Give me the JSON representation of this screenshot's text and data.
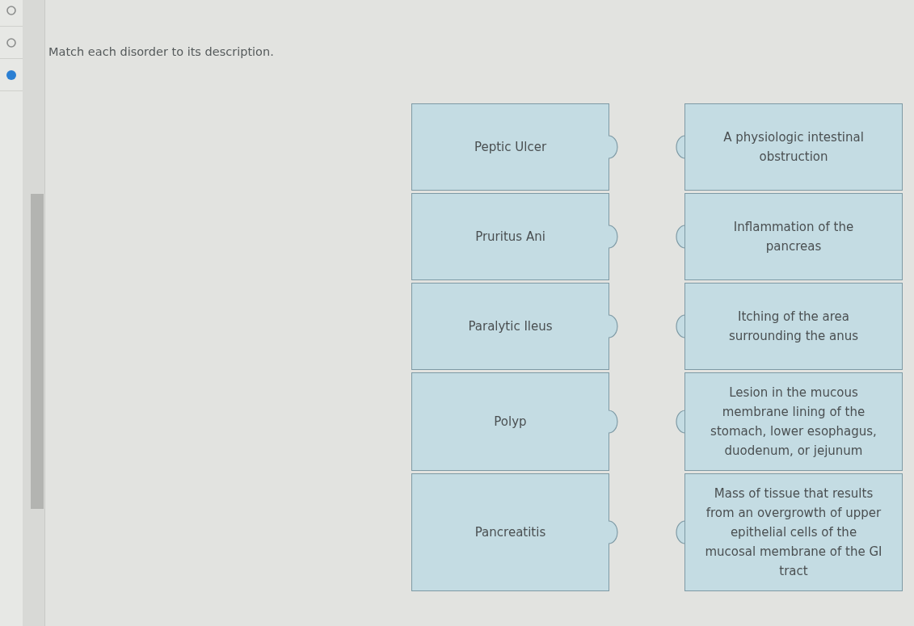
{
  "question_nav": [
    {
      "selected": false
    },
    {
      "selected": false
    },
    {
      "selected": true
    }
  ],
  "prompt": "Match each disorder to its description.",
  "terms": [
    "Peptic Ulcer",
    "Pruritus Ani",
    "Paralytic Ileus",
    "Polyp",
    "Pancreatitis"
  ],
  "descriptions": [
    "A physiologic intestinal\nobstruction",
    "Inflammation of the\npancreas",
    "Itching of the area\nsurrounding the anus",
    "Lesion in the mucous\nmembrane lining of the\nstomach, lower esophagus,\nduodenum, or jejunum",
    "Mass of tissue that results\nfrom an overgrowth of upper\nepithelial cells of the\nmucosal membrane of the GI\ntract"
  ]
}
